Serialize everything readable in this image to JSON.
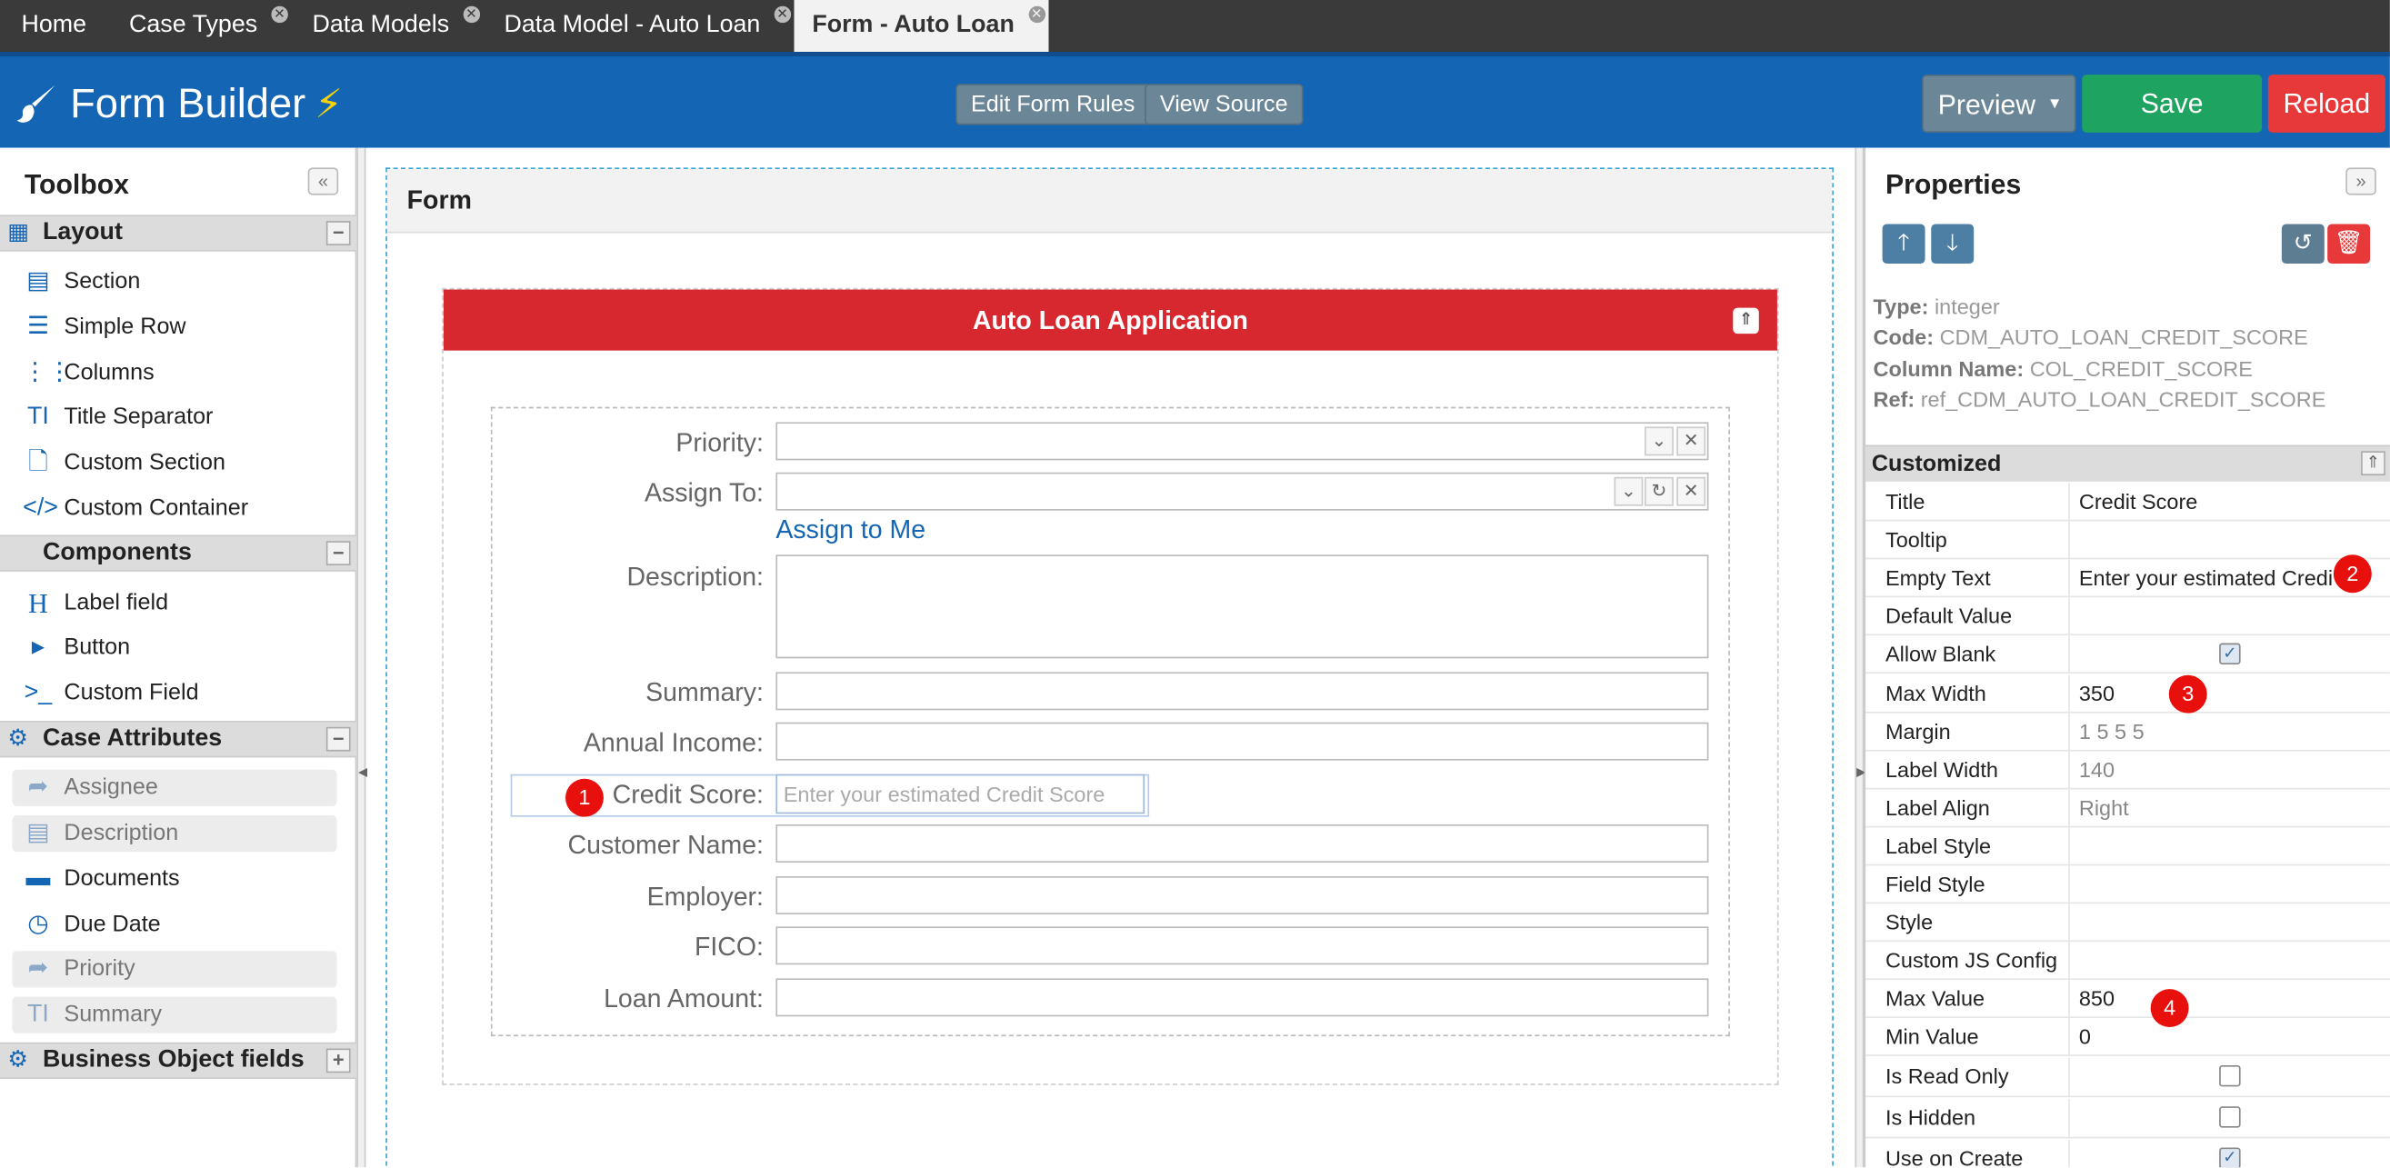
{
  "tabs": [
    {
      "label": "Home"
    },
    {
      "label": "Case Types"
    },
    {
      "label": "Data Models"
    },
    {
      "label": "Data Model - Auto Loan"
    },
    {
      "label": "Form - Auto Loan"
    }
  ],
  "header": {
    "title": "Form Builder",
    "edit_rules": "Edit Form Rules",
    "view_source": "View Source",
    "preview": "Preview",
    "save": "Save",
    "reload": "Reload"
  },
  "toolbox": {
    "title": "Toolbox",
    "layout": {
      "label": "Layout",
      "items": [
        "Section",
        "Simple Row",
        "Columns",
        "Title Separator",
        "Custom Section",
        "Custom Container"
      ]
    },
    "components": {
      "label": "Components",
      "items": [
        "Label field",
        "Button",
        "Custom Field"
      ]
    },
    "case_attributes": {
      "label": "Case Attributes",
      "items": [
        "Assignee",
        "Description",
        "Documents",
        "Due Date",
        "Priority",
        "Summary"
      ]
    },
    "business_object": {
      "label": "Business Object fields"
    }
  },
  "form": {
    "title": "Form",
    "section_title": "Auto Loan Application",
    "fields": {
      "priority": "Priority:",
      "assign_to": "Assign To:",
      "assign_to_me": "Assign to Me",
      "description": "Description:",
      "summary": "Summary:",
      "annual_income": "Annual Income:",
      "credit_score": "Credit Score:",
      "credit_score_placeholder": "Enter your estimated Credit Score",
      "customer_name": "Customer Name:",
      "employer": "Employer:",
      "fico": "FICO:",
      "loan_amount": "Loan Amount:"
    }
  },
  "badges": [
    "1",
    "2",
    "3",
    "4"
  ],
  "properties": {
    "title": "Properties",
    "meta": {
      "type_k": "Type:",
      "type_v": "integer",
      "code_k": "Code:",
      "code_v": "CDM_AUTO_LOAN_CREDIT_SCORE",
      "col_k": "Column Name:",
      "col_v": "COL_CREDIT_SCORE",
      "ref_k": "Ref:",
      "ref_v": "ref_CDM_AUTO_LOAN_CREDIT_SCORE"
    },
    "section": "Customized",
    "rows": [
      {
        "k": "Title",
        "v": "Credit Score"
      },
      {
        "k": "Tooltip",
        "v": ""
      },
      {
        "k": "Empty Text",
        "v": "Enter your estimated Credi"
      },
      {
        "k": "Default Value",
        "v": ""
      },
      {
        "k": "Allow Blank",
        "v": ""
      },
      {
        "k": "Max Width",
        "v": "350"
      },
      {
        "k": "Margin",
        "v": "1 5 5 5"
      },
      {
        "k": "Label Width",
        "v": "140"
      },
      {
        "k": "Label Align",
        "v": "Right"
      },
      {
        "k": "Label Style",
        "v": ""
      },
      {
        "k": "Field Style",
        "v": ""
      },
      {
        "k": "Style",
        "v": ""
      },
      {
        "k": "Custom JS Config",
        "v": ""
      },
      {
        "k": "Max Value",
        "v": "850"
      },
      {
        "k": "Min Value",
        "v": "0"
      },
      {
        "k": "Is Read Only",
        "v": ""
      },
      {
        "k": "Is Hidden",
        "v": ""
      },
      {
        "k": "Use on Create",
        "v": ""
      }
    ]
  }
}
